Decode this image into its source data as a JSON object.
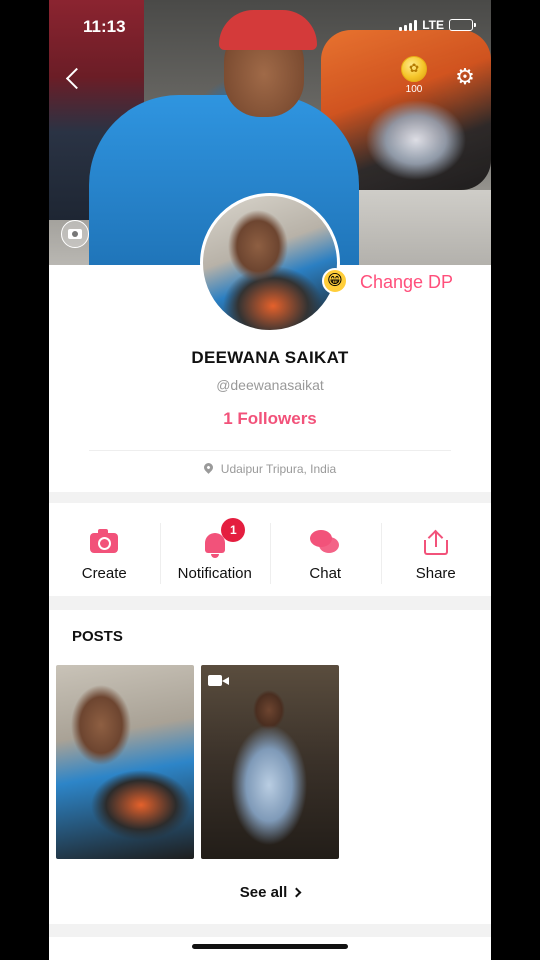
{
  "status_bar": {
    "time": "11:13",
    "network": "LTE"
  },
  "header": {
    "coins": "100"
  },
  "profile": {
    "change_dp_label": "Change DP",
    "name": "DEEWANA SAIKAT",
    "handle": "@deewanasaikat",
    "followers": "1 Followers",
    "location": "Udaipur Tripura, India"
  },
  "actions": [
    {
      "label": "Create",
      "icon": "camera-icon"
    },
    {
      "label": "Notification",
      "icon": "bell-icon",
      "badge": "1"
    },
    {
      "label": "Chat",
      "icon": "chat-icon"
    },
    {
      "label": "Share",
      "icon": "share-icon"
    }
  ],
  "posts": {
    "title": "POSTS",
    "see_all": "See all"
  },
  "colors": {
    "accent": "#f2527a",
    "badge": "#e41e3f"
  }
}
